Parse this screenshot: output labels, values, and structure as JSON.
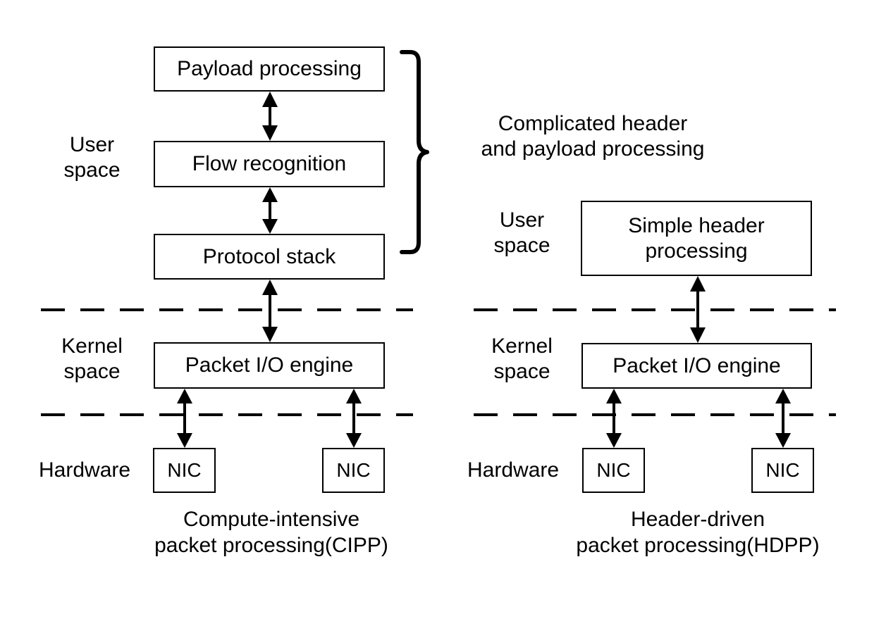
{
  "figure": {
    "background": "#ffffff",
    "stroke_color": "#000000",
    "text_color": "#000000"
  },
  "left_diagram": {
    "name": "Compute-intensive packet processing (CIPP)",
    "zone_labels": {
      "user_space": "User\nspace",
      "kernel_space": "Kernel\nspace",
      "hardware": "Hardware"
    },
    "boxes": [
      {
        "id": "payload-processing",
        "label": "Payload processing"
      },
      {
        "id": "flow-recognition",
        "label": "Flow recognition"
      },
      {
        "id": "protocol-stack",
        "label": "Protocol stack"
      },
      {
        "id": "packet-io-engine",
        "label": "Packet I/O engine"
      },
      {
        "id": "nic-left",
        "label": "NIC"
      },
      {
        "id": "nic-right",
        "label": "NIC"
      }
    ],
    "brace_annotation": "Complicated header\nand payload processing",
    "caption": "Compute-intensive\npacket processing(CIPP)"
  },
  "right_diagram": {
    "name": "Header-driven packet processing (HDPP)",
    "zone_labels": {
      "user_space": "User\nspace",
      "kernel_space": "Kernel\nspace",
      "hardware": "Hardware"
    },
    "boxes": [
      {
        "id": "simple-header-processing",
        "label": "Simple header\nprocessing"
      },
      {
        "id": "packet-io-engine",
        "label": "Packet I/O engine"
      },
      {
        "id": "nic-left",
        "label": "NIC"
      },
      {
        "id": "nic-right",
        "label": "NIC"
      }
    ],
    "caption": "Header-driven\npacket processing(HDPP)"
  }
}
